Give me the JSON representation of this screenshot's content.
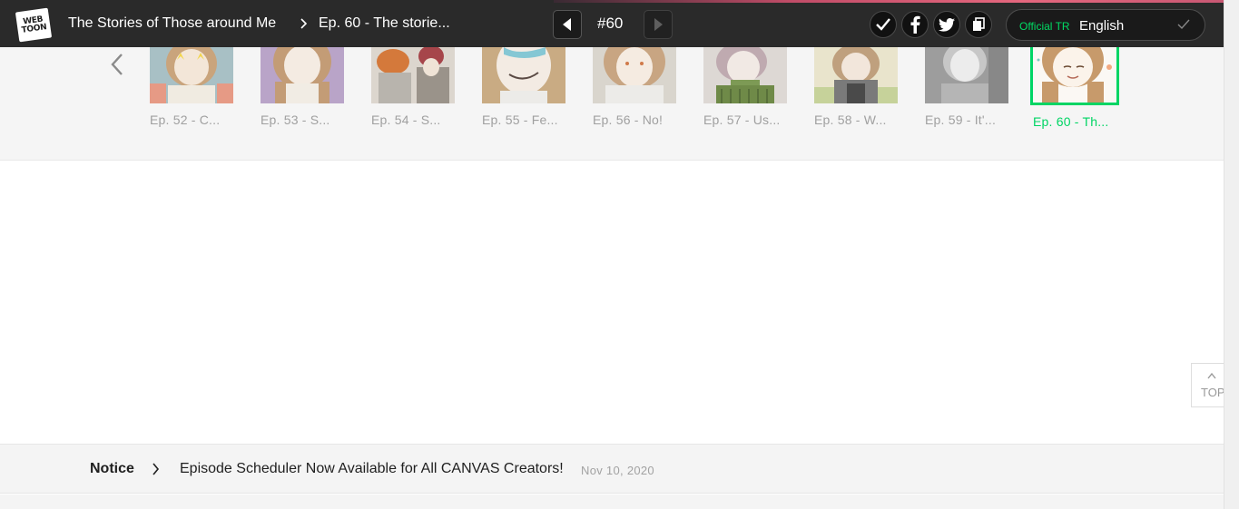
{
  "header": {
    "logo_line1": "WEB",
    "logo_line2": "TOON",
    "series_title": "The Stories of Those around Me",
    "episode_title": "Ep. 60 - The storie...",
    "episode_number": "#60",
    "language_badge": "Official TR",
    "language": "English",
    "icons": [
      "check-icon",
      "facebook-icon",
      "twitter-icon",
      "copy-link-icon"
    ]
  },
  "episodes": [
    {
      "label": "Ep. 52 - C..."
    },
    {
      "label": "Ep. 53 - S..."
    },
    {
      "label": "Ep. 54 - S..."
    },
    {
      "label": "Ep. 55 - Fe..."
    },
    {
      "label": "Ep. 56 - No!"
    },
    {
      "label": "Ep. 57 - Us..."
    },
    {
      "label": "Ep. 58 - W..."
    },
    {
      "label": "Ep. 59 - It'..."
    },
    {
      "label": "Ep. 60 - Th...",
      "current": true
    }
  ],
  "top_button": {
    "label": "TOP"
  },
  "notice": {
    "label": "Notice",
    "text": "Episode Scheduler Now Available for All CANVAS Creators!",
    "date": "Nov 10, 2020"
  },
  "colors": {
    "accent": "#00d564",
    "header_bg": "#2a2a2a",
    "strip_bg": "#f5f5f5"
  }
}
